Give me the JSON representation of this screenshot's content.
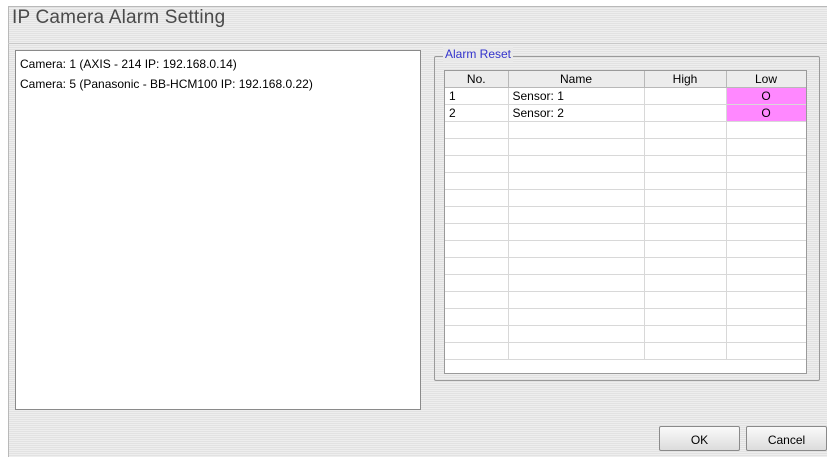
{
  "window": {
    "title": "IP Camera Alarm Setting"
  },
  "cameras": [
    "Camera: 1 (AXIS - 214 IP: 192.168.0.14)",
    "Camera: 5 (Panasonic - BB-HCM100 IP: 192.168.0.22)"
  ],
  "alarm_reset": {
    "group_label": "Alarm Reset",
    "columns": [
      "No.",
      "Name",
      "High",
      "Low"
    ],
    "rows": [
      {
        "no": "1",
        "name": "Sensor: 1",
        "high": "",
        "low": "O"
      },
      {
        "no": "2",
        "name": "Sensor: 2",
        "high": "",
        "low": "O"
      }
    ],
    "empty_rows": 14,
    "selected_color": "#ff88ff"
  },
  "buttons": {
    "ok": "OK",
    "cancel": "Cancel"
  }
}
